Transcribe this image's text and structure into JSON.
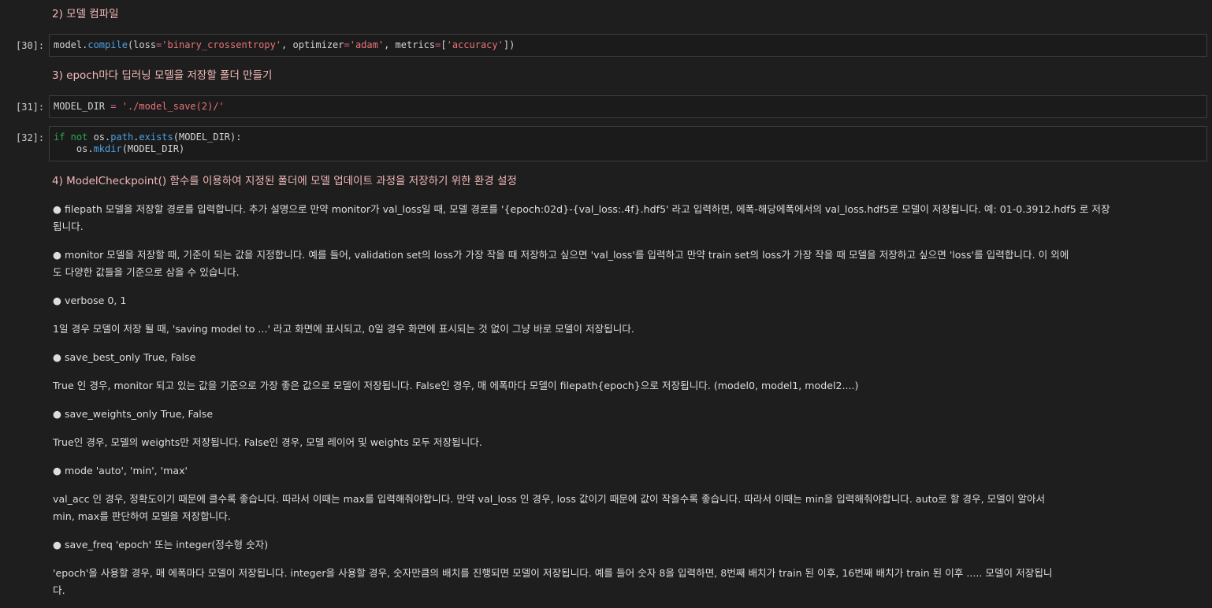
{
  "cells": {
    "h2": "2) 모델 컴파일",
    "c30": {
      "prompt": "[30]:",
      "t1": "model.",
      "t2": "compile",
      "t3": "(loss",
      "t4": "=",
      "t5": "'binary_crossentropy'",
      "t6": ", optimizer",
      "t7": "=",
      "t8": "'adam'",
      "t9": ", metrics",
      "t10": "=",
      "t11": "[",
      "t12": "'accuracy'",
      "t13": "])"
    },
    "h3": "3) epoch마다 딥러닝 모델을 저장할 폴더 만들기",
    "c31": {
      "prompt": "[31]:",
      "t1": "MODEL_DIR ",
      "t2": "=",
      "t3": " ",
      "t4": "'./model_save(2)/'"
    },
    "c32": {
      "prompt": "[32]:",
      "l1a": "if not",
      "l1b": " os.",
      "l1c": "path",
      "l1d": ".",
      "l1e": "exists",
      "l1f": "(MODEL_DIR):",
      "l2a": "    os.",
      "l2b": "mkdir",
      "l2c": "(MODEL_DIR)"
    },
    "h4": "4) ModelCheckpoint() 함수를 이용하여 지정된 폴더에 모델 업데이트 과정을 저장하기 위한 환경 설정",
    "p1a": "● filepath 모델을 저장할 경로를 입력합니다. 추가 설명으로 만약 monitor가 val_loss일 때, 모델 경로를 '{epoch:02d}-{val_loss:.4f}.hdf5' 라고 입력하면, 에폭-해당에폭에서의 val_loss.hdf5로 모델이 저장됩니다. 예: 01-0.3912.hdf5 로 저장",
    "p1b": "됩니다.",
    "p2a": "● monitor 모델을 저장할 때, 기준이 되는 값을 지정합니다. 예를 들어, validation set의 loss가 가장 작을 때 저장하고 싶으면 'val_loss'를 입력하고 만약 train set의 loss가 가장 작을 때 모델을 저장하고 싶으면 'loss'를 입력합니다. 이 외에",
    "p2b": "도 다양한 값들을 기준으로 삼을 수 있습니다.",
    "p3": "● verbose 0, 1",
    "p4": "1일 경우 모델이 저장 될 때, 'saving model to ...' 라고 화면에 표시되고, 0일 경우 화면에 표시되는 것 없이 그냥 바로 모델이 저장됩니다.",
    "p5": "● save_best_only True, False",
    "p6": "True 인 경우, monitor 되고 있는 값을 기준으로 가장 좋은 값으로 모델이 저장됩니다. False인 경우, 매 에폭마다 모델이 filepath{epoch}으로 저장됩니다. (model0, model1, model2....)",
    "p7": "● save_weights_only True, False",
    "p8": "True인 경우, 모델의 weights만 저장됩니다. False인 경우, 모델 레이어 및 weights 모두 저장됩니다.",
    "p9": "● mode 'auto', 'min', 'max'",
    "p10a": "val_acc 인 경우, 정확도이기 때문에 클수록 좋습니다. 따라서 이때는 max를 입력해줘야합니다. 만약 val_loss 인 경우, loss 값이기 때문에 값이 작을수록 좋습니다. 따라서 이때는 min을 입력해줘야합니다. auto로 할 경우, 모델이 알아서",
    "p10b": "min, max를 판단하여 모델을 저장합니다.",
    "p11": "● save_freq 'epoch' 또는 integer(정수형 숫자)",
    "p12a": "'epoch'을 사용할 경우, 매 에폭마다 모델이 저장됩니다. integer을 사용할 경우, 숫자만큼의 배치를 진행되면 모델이 저장됩니다. 예를 들어 숫자 8을 입력하면, 8번째 배치가 train 된 이후, 16번째 배치가 train 된 이후 ..... 모델이 저장됩니",
    "p12b": "다."
  },
  "colors": {
    "background": "#1e1e1e",
    "heading": "#f2b8b8",
    "keyword": "#2fa84f",
    "function": "#4ea1e0",
    "string": "#e8747b",
    "operator": "#d1609e"
  }
}
